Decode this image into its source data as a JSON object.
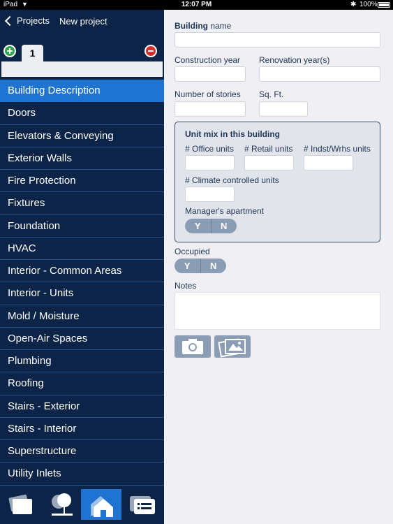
{
  "status_bar": {
    "carrier": "iPad",
    "time": "12:07 PM",
    "battery": "100%"
  },
  "nav": {
    "back_label": "Projects",
    "title": "New project"
  },
  "tabs": {
    "current": "1"
  },
  "sections": [
    "Building Description",
    "Doors",
    "Elevators & Conveying",
    "Exterior Walls",
    "Fire Protection",
    "Fixtures",
    "Foundation",
    "HVAC",
    "Interior - Common Areas",
    "Interior - Units",
    "Mold / Moisture",
    "Open-Air Spaces",
    "Plumbing",
    "Roofing",
    "Stairs - Exterior",
    "Stairs - Interior",
    "Superstructure",
    "Utility Inlets"
  ],
  "active_section": "Building Description",
  "form": {
    "building_name_bold": "Building",
    "building_name_rest": " name",
    "construction_year": "Construction year",
    "renovation_years": "Renovation year(s)",
    "number_of_stories": "Number of stories",
    "sq_ft": "Sq. Ft.",
    "unit_mix_title": "Unit mix in this building",
    "office_units": "# Office units",
    "retail_units": "# Retail units",
    "indst_units": "# Indst/Wrhs units",
    "climate_units": "# Climate controlled units",
    "managers_apartment": "Manager's apartment",
    "occupied": "Occupied",
    "notes": "Notes",
    "yes": "Y",
    "no": "N"
  },
  "colors": {
    "sidebar_bg": "#0d2449",
    "active": "#1f73d1",
    "toggle": "#8a9db4"
  },
  "icons": {
    "bottom_bar": [
      "cards-icon",
      "trees-icon",
      "house-icon",
      "list-icon"
    ],
    "photo": [
      "camera-icon",
      "photo-library-icon"
    ]
  }
}
